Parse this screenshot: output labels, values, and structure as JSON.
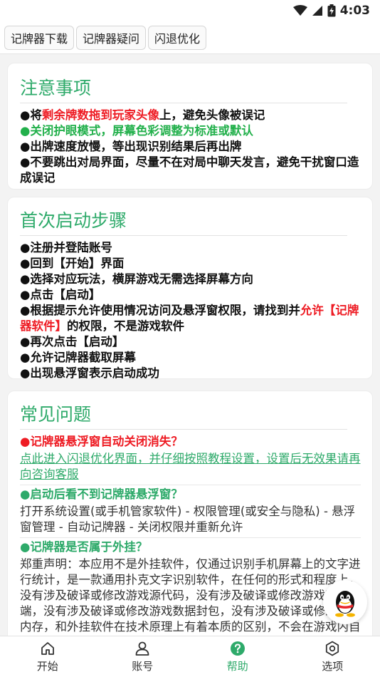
{
  "status_bar": {
    "time": "4:03"
  },
  "tabs": [
    {
      "label": "记牌器下载"
    },
    {
      "label": "记牌器疑问"
    },
    {
      "label": "闪退优化"
    }
  ],
  "notice": {
    "title": "注意事项",
    "line1": {
      "bullet": "●将",
      "highlight": "剩余牌数拖到玩家头像",
      "rest": "上，避免头像被误记"
    },
    "line2": "●关闭护眼模式，屏幕色彩调整为标准或默认",
    "line3": "●出牌速度放慢，等出现识别结果后再出牌",
    "line4": "●不要跳出对局界面，尽量不在对局中聊天发言，避免干扰窗口造成误记"
  },
  "startup": {
    "title": "首次启动步骤",
    "steps": [
      "●注册并登陆账号",
      "●回到【开始】界面",
      "●选择对应玩法，横屏游戏无需选择屏幕方向",
      "●点击【启动】"
    ],
    "permission": {
      "text": "●根据提示允许使用情况访问及悬浮窗权限，请找到并",
      "highlight": "允许【记牌器软件】",
      "rest": "的权限，不是游戏软件"
    },
    "steps_after": [
      "●再次点击【启动】",
      "●允许记牌器截取屏幕",
      "●出现悬浮窗表示启动成功"
    ]
  },
  "faq": {
    "title": "常见问题",
    "q1": "●记牌器悬浮窗自动关闭消失？",
    "a1_link": "点此进入闪退优化界面，并仔细按照教程设置，设置后无效果请再向咨询客服",
    "q2": "●启动后看不到记牌器悬浮窗？",
    "a2": "打开系统设置(或手机管家软件) - 权限管理(或安全与隐私) - 悬浮窗管理 - 自动记牌器 - 关闭权限并重新允许",
    "q3": "●记牌器是否属于外挂？",
    "a3": "郑重声明：本应用不是外挂软件，仅通过识别手机屏幕上的文字进行统计，是一款通用扑克文字识别软件，在任何的形式和程度上，没有涉及破译或修改游戏源代码，没有涉及破译或修改游戏客户端，没有涉及破译或修改游戏数据封包，没有涉及破译或修改游戏内存，和外挂软件在技术原理上有着本质的区别，不会在游戏内自动点击操作游戏，不会干扰游戏客户端和"
  },
  "bottom_nav": [
    {
      "label": "开始",
      "icon": "home-icon",
      "active": false
    },
    {
      "label": "账号",
      "icon": "user-icon",
      "active": false
    },
    {
      "label": "帮助",
      "icon": "help-icon",
      "active": true
    },
    {
      "label": "选项",
      "icon": "settings-icon",
      "active": false
    }
  ],
  "colors": {
    "accent_green": "#2eaa6a",
    "warning_red": "#ee1c24",
    "highlight_green": "#22b04b"
  }
}
